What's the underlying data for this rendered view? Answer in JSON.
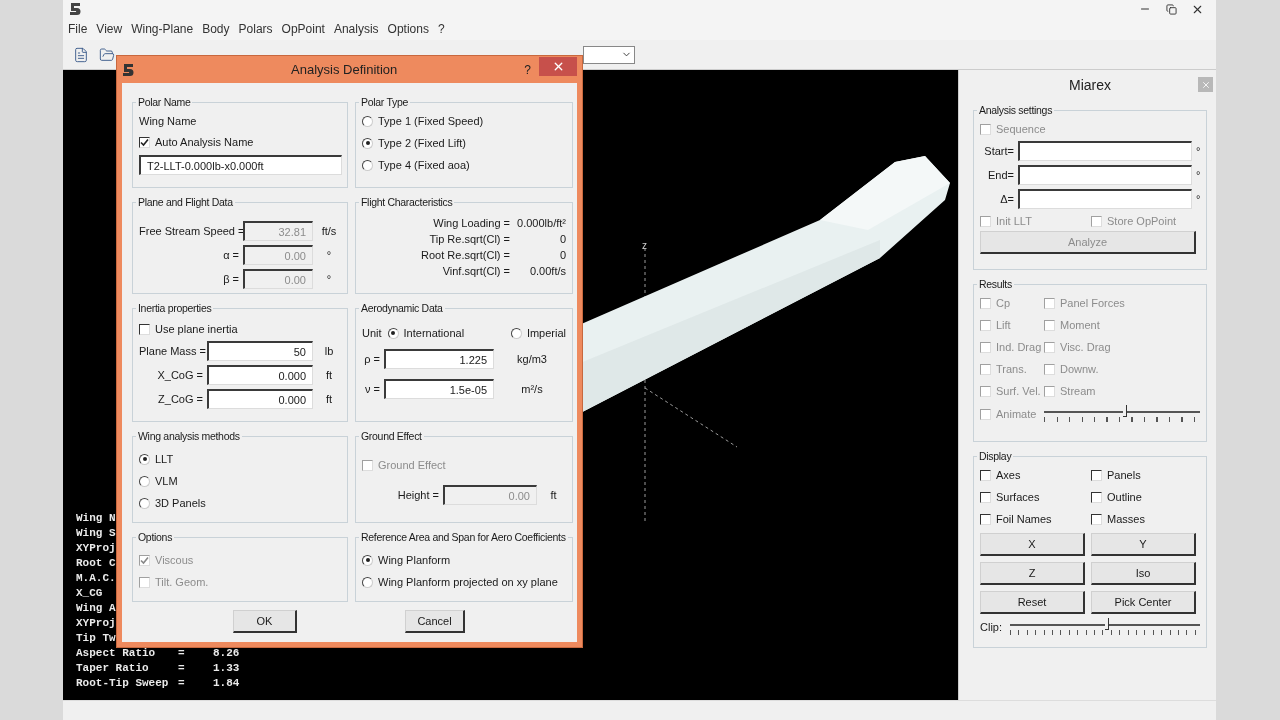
{
  "window": {
    "menu": [
      "File",
      "View",
      "Wing-Plane",
      "Body",
      "Polars",
      "OpPoint",
      "Analysis",
      "Options",
      "?"
    ]
  },
  "view3d": {
    "axis_label": "z",
    "info": [
      {
        "label": "Wing N"
      },
      {
        "label": "Wing S"
      },
      {
        "label": "XYProj"
      },
      {
        "label": "Root C"
      },
      {
        "label": "M.A.C."
      },
      {
        "label": "X_CG"
      },
      {
        "label": "Wing A"
      },
      {
        "label": "XYProj"
      },
      {
        "label": "Tip Tw"
      },
      {
        "label": "Aspect Ratio",
        "eq": "=",
        "value": "8.26"
      },
      {
        "label": "Taper Ratio",
        "eq": "=",
        "value": "1.33"
      },
      {
        "label": "Root-Tip Sweep",
        "eq": "=",
        "value": "1.84"
      }
    ]
  },
  "dialog": {
    "title": "Analysis Definition",
    "help": "?",
    "polar_name": {
      "title": "Polar Name",
      "wing_name_label": "Wing Name",
      "auto_name": {
        "label": "Auto Analysis Name",
        "checked": true
      },
      "name_value": "T2-LLT-0.000lb-x0.000ft"
    },
    "polar_type": {
      "title": "Polar Type",
      "options": [
        {
          "label": "Type 1 (Fixed Speed)",
          "selected": false
        },
        {
          "label": "Type 2 (Fixed Lift)",
          "selected": true
        },
        {
          "label": "Type 4 (Fixed aoa)",
          "selected": false
        }
      ]
    },
    "plane_flight": {
      "title": "Plane and Flight Data",
      "fields": [
        {
          "label": "Free Stream Speed =",
          "value": "32.81",
          "unit": "ft/s",
          "disabled": true
        },
        {
          "label": "α =",
          "value": "0.00",
          "unit": "°",
          "disabled": true
        },
        {
          "label": "β =",
          "value": "0.00",
          "unit": "°",
          "disabled": true
        }
      ]
    },
    "flight_characteristics": {
      "title": "Flight Characteristics",
      "rows": [
        {
          "label": "Wing Loading =",
          "value": "0.000lb/ft²"
        },
        {
          "label": "Tip Re.sqrt(Cl) =",
          "value": "0"
        },
        {
          "label": "Root Re.sqrt(Cl) =",
          "value": "0"
        },
        {
          "label": "Vinf.sqrt(Cl) =",
          "value": "0.00ft/s"
        }
      ]
    },
    "inertia": {
      "title": "Inertia properties",
      "use_plane_inertia": {
        "label": "Use plane inertia",
        "checked": false
      },
      "fields": [
        {
          "label": "Plane Mass =",
          "value": "50",
          "unit": "lb",
          "disabled": false
        },
        {
          "label": "X_CoG =",
          "value": "0.000",
          "unit": "ft",
          "disabled": false
        },
        {
          "label": "Z_CoG =",
          "value": "0.000",
          "unit": "ft",
          "disabled": false
        }
      ]
    },
    "aerodynamic": {
      "title": "Aerodynamic Data",
      "unit_label": "Unit",
      "units": [
        {
          "label": "International",
          "selected": true
        },
        {
          "label": "Imperial",
          "selected": false
        }
      ],
      "fields": [
        {
          "label": "ρ =",
          "value": "1.225",
          "unit": "kg/m3",
          "disabled": false
        },
        {
          "label": "ν =",
          "value": "1.5e-05",
          "unit": "m²/s",
          "disabled": false
        }
      ]
    },
    "methods": {
      "title": "Wing analysis methods",
      "options": [
        {
          "label": "LLT",
          "selected": true
        },
        {
          "label": "VLM",
          "selected": false
        },
        {
          "label": "3D Panels",
          "selected": false
        }
      ]
    },
    "ground_effect": {
      "title": "Ground Effect",
      "check": {
        "label": "Ground Effect",
        "checked": false,
        "disabled": true
      },
      "height": {
        "label": "Height =",
        "value": "0.00",
        "unit": "ft",
        "disabled": true
      }
    },
    "options": {
      "title": "Options",
      "checks": [
        {
          "label": "Viscous",
          "checked": true,
          "disabled": true
        },
        {
          "label": "Tilt. Geom.",
          "checked": false,
          "disabled": true
        }
      ]
    },
    "reference": {
      "title": "Reference Area and Span for Aero Coefficients",
      "options": [
        {
          "label": "Wing Planform",
          "selected": true
        },
        {
          "label": "Wing Planform projected on xy plane",
          "selected": false
        }
      ]
    },
    "buttons": [
      "OK",
      "Cancel"
    ]
  },
  "miarex": {
    "title": "Miarex",
    "analysis": {
      "title": "Analysis settings",
      "sequence": {
        "label": "Sequence",
        "checked": false,
        "disabled": true
      },
      "fields": [
        {
          "label": "Start=",
          "unit": "°"
        },
        {
          "label": "End=",
          "unit": "°"
        },
        {
          "label": "Δ=",
          "unit": "°"
        }
      ],
      "checks": [
        {
          "label": "Init LLT",
          "checked": false,
          "disabled": true
        },
        {
          "label": "Store OpPoint",
          "checked": false,
          "disabled": true
        }
      ],
      "analyze": {
        "label": "Analyze",
        "disabled": true
      }
    },
    "results": {
      "title": "Results",
      "checks": [
        {
          "label": "Cp",
          "checked": false,
          "disabled": true
        },
        {
          "label": "Panel Forces",
          "checked": false,
          "disabled": true
        },
        {
          "label": "Lift",
          "checked": false,
          "disabled": true
        },
        {
          "label": "Moment",
          "checked": false,
          "disabled": true
        },
        {
          "label": "Ind. Drag",
          "checked": false,
          "disabled": true
        },
        {
          "label": "Visc. Drag",
          "checked": false,
          "disabled": true
        },
        {
          "label": "Trans.",
          "checked": false,
          "disabled": true
        },
        {
          "label": "Downw.",
          "checked": false,
          "disabled": true
        },
        {
          "label": "Surf. Vel.",
          "checked": false,
          "disabled": true
        },
        {
          "label": "Stream",
          "checked": false,
          "disabled": true
        }
      ],
      "animate": {
        "label": "Animate",
        "checked": false,
        "disabled": true
      },
      "animation_slider": {
        "level": 0.52
      }
    },
    "display": {
      "title": "Display",
      "checks": [
        {
          "label": "Axes",
          "checked": false
        },
        {
          "label": "Panels",
          "checked": false
        },
        {
          "label": "Surfaces",
          "checked": false
        },
        {
          "label": "Outline",
          "checked": false
        },
        {
          "label": "Foil Names",
          "checked": false
        },
        {
          "label": "Masses",
          "checked": false
        }
      ],
      "buttons": [
        "X",
        "Y",
        "Z",
        "Iso",
        "Reset",
        "Pick Center"
      ],
      "clip": {
        "label": "Clip:",
        "level": 0.51
      }
    }
  }
}
